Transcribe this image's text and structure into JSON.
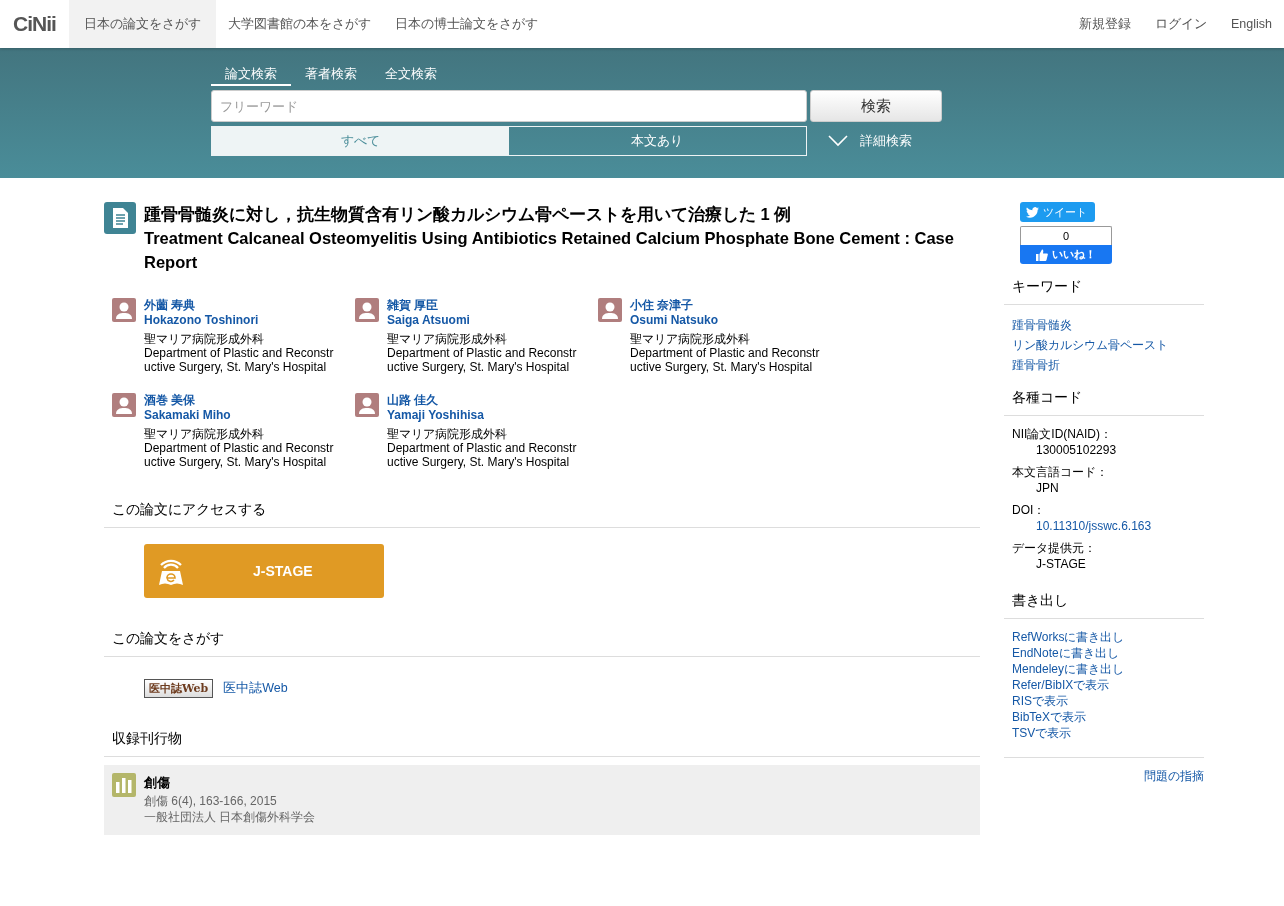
{
  "logo": "CiNii",
  "nav": [
    {
      "label": "日本の論文をさがす",
      "selected": true
    },
    {
      "label": "大学図書館の本をさがす",
      "selected": false
    },
    {
      "label": "日本の博士論文をさがす",
      "selected": false
    }
  ],
  "account_links": [
    "新規登録",
    "ログイン",
    "English"
  ],
  "search": {
    "tabs": [
      {
        "label": "論文検索",
        "selected": true
      },
      {
        "label": "著者検索",
        "selected": false
      },
      {
        "label": "全文検索",
        "selected": false
      }
    ],
    "placeholder": "フリーワード",
    "button": "検索",
    "scopes": [
      {
        "label": "すべて",
        "selected": true
      },
      {
        "label": "本文あり",
        "selected": false
      }
    ],
    "advanced": "詳細検索"
  },
  "article": {
    "title_ja": "踵骨骨髄炎に対し，抗生物質含有リン酸カルシウム骨ペーストを用いて治療した 1 例",
    "title_en": "Treatment Calcaneal Osteomyelitis Using Antibiotics Retained Calcium Phosphate Bone Cement : Case Report",
    "authors": [
      {
        "name_ja": "外薗 寿典",
        "name_en": "Hokazono Toshinori",
        "affiliation_ja": "聖マリア病院形成外科",
        "affiliation_en": "Department of Plastic and Reconstructive Surgery, St. Mary's Hospital"
      },
      {
        "name_ja": "雑賀 厚臣",
        "name_en": "Saiga Atsuomi",
        "affiliation_ja": "聖マリア病院形成外科",
        "affiliation_en": "Department of Plastic and Reconstructive Surgery, St. Mary's Hospital"
      },
      {
        "name_ja": "小住 奈津子",
        "name_en": "Osumi Natsuko",
        "affiliation_ja": "聖マリア病院形成外科",
        "affiliation_en": "Department of Plastic and Reconstructive Surgery, St. Mary's Hospital"
      },
      {
        "name_ja": "酒巻 美保",
        "name_en": "Sakamaki Miho",
        "affiliation_ja": "聖マリア病院形成外科",
        "affiliation_en": "Department of Plastic and Reconstructive Surgery, St. Mary's Hospital"
      },
      {
        "name_ja": "山路 佳久",
        "name_en": "Yamaji Yoshihisa",
        "affiliation_ja": "聖マリア病院形成外科",
        "affiliation_en": "Department of Plastic and Reconstructive Surgery, St. Mary's Hospital"
      }
    ],
    "access": {
      "heading": "この論文にアクセスする",
      "button": "J-STAGE"
    },
    "find": {
      "heading": "この論文をさがす",
      "badge": "医中誌Web",
      "link": "医中誌Web"
    },
    "journal": {
      "heading": "収録刊行物",
      "name": "創傷",
      "citation": "創傷 6(4), 163-166, 2015",
      "publisher": "一般社団法人 日本創傷外科学会"
    }
  },
  "sidebar": {
    "tweet": "ツイート",
    "like_count": "0",
    "like": "いいね！",
    "keywords": {
      "heading": "キーワード",
      "items": [
        "踵骨骨髄炎",
        "リン酸カルシウム骨ペースト",
        "踵骨骨折"
      ]
    },
    "codes": {
      "heading": "各種コード",
      "items": [
        {
          "label": "NII論文ID(NAID)：",
          "value": "130005102293",
          "kind": "text"
        },
        {
          "label": "本文言語コード：",
          "value": "JPN",
          "kind": "text"
        },
        {
          "label": "DOI：",
          "value": "10.11310/jsswc.6.163",
          "kind": "link"
        },
        {
          "label": "データ提供元：",
          "value": "J-STAGE",
          "kind": "text"
        }
      ]
    },
    "export": {
      "heading": "書き出し",
      "items": [
        "RefWorksに書き出し",
        "EndNoteに書き出し",
        "Mendeleyに書き出し",
        "Refer/BibIXで表示",
        "RISで表示",
        "BibTeXで表示",
        "TSVで表示"
      ]
    },
    "report": "問題の指摘"
  }
}
